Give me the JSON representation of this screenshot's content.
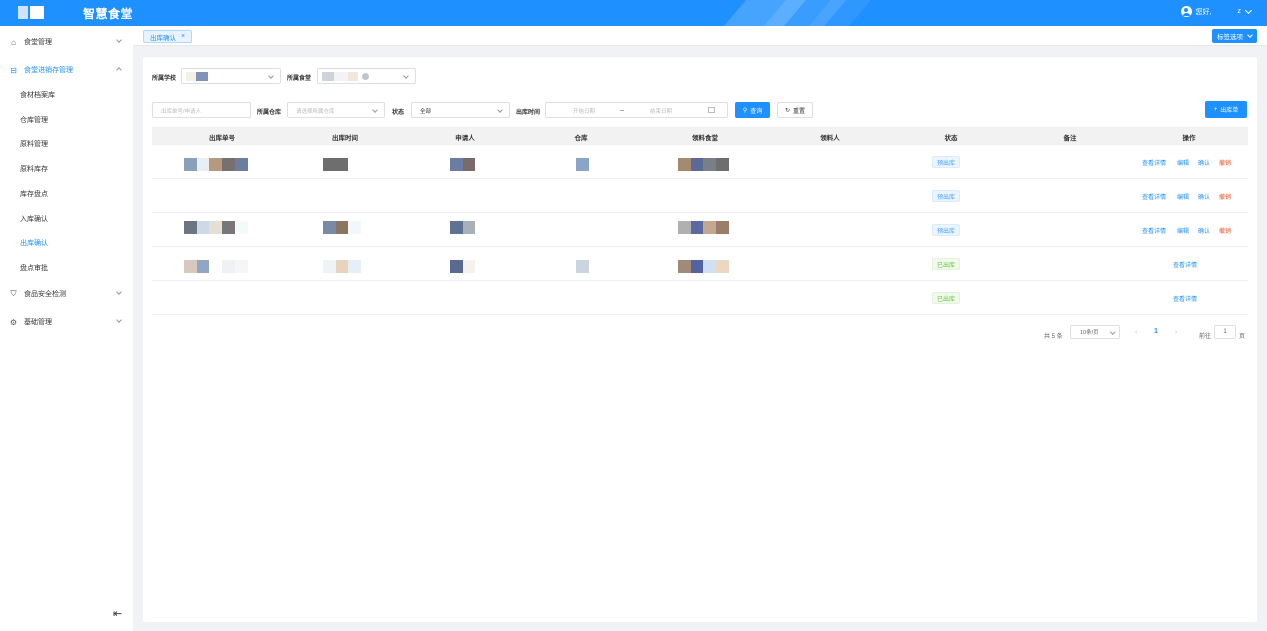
{
  "header": {
    "title": "智慧食堂",
    "user_greeting": "您好,",
    "user_name": "z",
    "colors": {
      "primary": "#1e90ff"
    }
  },
  "sidebar": {
    "groups": [
      {
        "label": "食堂管理",
        "icon": "home-icon"
      },
      {
        "label": "食堂进销存管理",
        "icon": "inventory-icon"
      },
      {
        "label": "食品安全检测",
        "icon": "shield-icon"
      },
      {
        "label": "基础管理",
        "icon": "gear-icon"
      }
    ],
    "subitems": [
      "食材档案库",
      "仓库管理",
      "原料管理",
      "原料库存",
      "库存盘点",
      "入库确认",
      "出库确认",
      "盘点审批"
    ]
  },
  "tabs": {
    "items": [
      {
        "label": "出库确认",
        "close": "×"
      }
    ],
    "options_label": "标签选项"
  },
  "filters": {
    "school_label": "所属学校",
    "canteen_label": "所属食堂",
    "search_placeholder": "出库单号/申请人",
    "warehouse_label": "所属仓库",
    "warehouse_placeholder": "请选择所属仓库",
    "status_label": "状态",
    "status_value": "全部",
    "time_label": "出库时间",
    "start_placeholder": "开始日期",
    "range_sep": "_",
    "end_placeholder": "结束日期",
    "query_label": "查询",
    "reset_label": "重置",
    "add_label": "出库单"
  },
  "table": {
    "columns": [
      "出库单号",
      "出库时间",
      "申请人",
      "仓库",
      "领料食堂",
      "领料人",
      "状态",
      "备注",
      "操作"
    ],
    "rows": [
      {
        "status": "预出库",
        "status_type": "pending",
        "actions": [
          "查看详情",
          "编辑",
          "确认",
          "撤销"
        ]
      },
      {
        "status": "预出库",
        "status_type": "pending",
        "actions": [
          "查看详情",
          "编辑",
          "确认",
          "撤销"
        ]
      },
      {
        "status": "预出库",
        "status_type": "pending",
        "actions": [
          "查看详情",
          "编辑",
          "确认",
          "撤销"
        ]
      },
      {
        "status": "已出库",
        "status_type": "done",
        "actions": [
          "查看详情"
        ]
      },
      {
        "status": "已出库",
        "status_type": "done",
        "actions": [
          "查看详情"
        ]
      }
    ]
  },
  "pagination": {
    "total": "共 5 条",
    "page_size": "10条/页",
    "current_page": "1",
    "jump_label": "前往",
    "jump_value": "1",
    "page_suffix": "页"
  }
}
